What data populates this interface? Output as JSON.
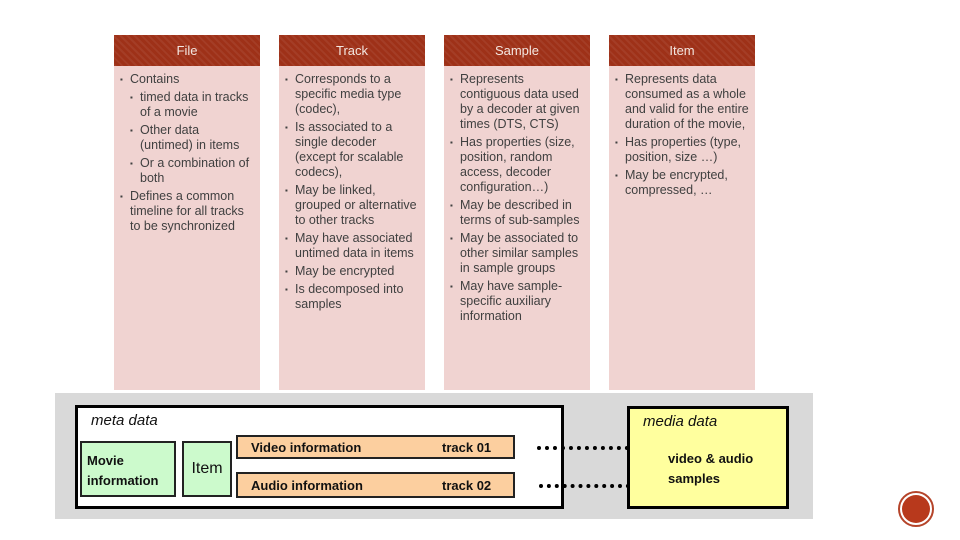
{
  "columns": [
    {
      "title": "File",
      "items": [
        {
          "level": 1,
          "text": "Contains"
        },
        {
          "level": 2,
          "text": "timed data in tracks of a movie"
        },
        {
          "level": 2,
          "text": "Other data (untimed) in items"
        },
        {
          "level": 2,
          "text": "Or a combination of both"
        },
        {
          "level": 1,
          "text": "Defines a common timeline for all tracks to be synchronized"
        }
      ]
    },
    {
      "title": "Track",
      "items": [
        {
          "level": 1,
          "text": "Corresponds to a specific media type (codec),"
        },
        {
          "level": 1,
          "text": "Is associated to a single decoder (except for scalable codecs),"
        },
        {
          "level": 1,
          "text": "May be linked, grouped or alternative to other tracks"
        },
        {
          "level": 1,
          "text": "May have associated untimed data in items"
        },
        {
          "level": 1,
          "text": "May be encrypted"
        },
        {
          "level": 1,
          "text": "Is decomposed into samples"
        }
      ]
    },
    {
      "title": "Sample",
      "items": [
        {
          "level": 1,
          "text": "Represents contiguous data used by a decoder at given times (DTS, CTS)"
        },
        {
          "level": 1,
          "text": "Has properties (size, position, random access, decoder configuration…)"
        },
        {
          "level": 1,
          "text": "May be described in terms of sub-samples"
        },
        {
          "level": 1,
          "text": "May be associated to other similar samples in sample groups"
        },
        {
          "level": 1,
          "text": "May have sample-specific auxiliary information"
        }
      ]
    },
    {
      "title": "Item",
      "items": [
        {
          "level": 1,
          "text": "Represents data consumed as a whole and valid for the entire duration of the movie,"
        },
        {
          "level": 1,
          "text": "Has properties (type, position, size …)"
        },
        {
          "level": 1,
          "text": "May be encrypted, compressed, …"
        }
      ]
    }
  ],
  "diagram": {
    "meta_label": "meta data",
    "movie_info": "Movie information",
    "item": "Item",
    "video_info": "Video information",
    "video_track": "track 01",
    "audio_info": "Audio information",
    "audio_track": "track 02",
    "media_label": "media data",
    "media_content": "video & audio samples"
  },
  "colors": {
    "header": "#9e3118",
    "column_bg": "#f0d3d1",
    "green": "#ccfacc",
    "orange": "#fccf9f",
    "yellow": "#ffff9e"
  }
}
